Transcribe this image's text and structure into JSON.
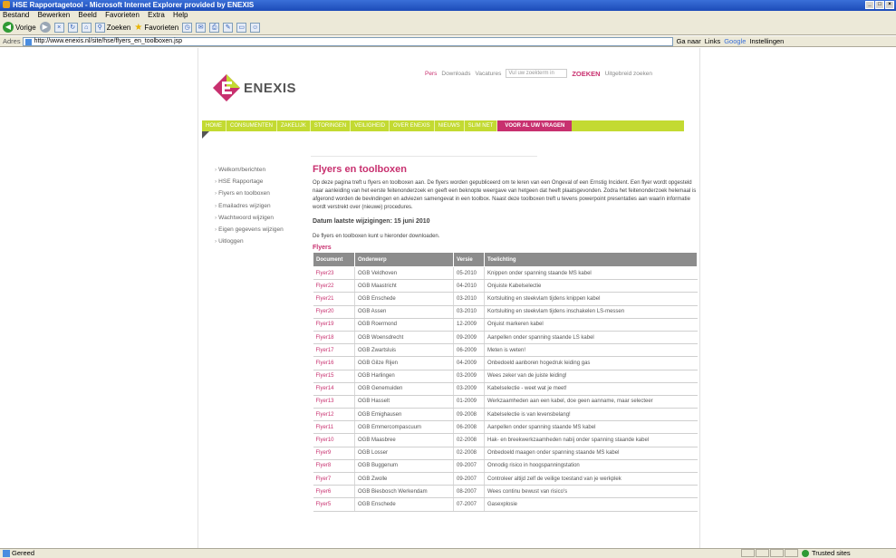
{
  "window": {
    "title": "HSE Rapportagetool - Microsoft Internet Explorer provided by ENEXIS"
  },
  "menubar": [
    "Bestand",
    "Bewerken",
    "Beeld",
    "Favorieten",
    "Extra",
    "Help"
  ],
  "toolbar": {
    "back": "Vorige",
    "search": "Zoeken",
    "favorites": "Favorieten"
  },
  "addressbar": {
    "label": "Adres",
    "url": "http://www.enexis.nl/site/hse/flyers_en_toolboxen.jsp",
    "go": "Ga naar",
    "links": "Links",
    "google": "Google",
    "settings": "Instellingen"
  },
  "site": {
    "logo": "ENEXIS",
    "topnav": {
      "pers": "Pers",
      "downloads": "Downloads",
      "vacatures": "Vacatures",
      "search_placeholder": "Vul uw zoekterm in",
      "search_button": "ZOEKEN",
      "advanced": "Uitgebreid zoeken"
    },
    "mainnav": [
      "HOME",
      "CONSUMENTEN",
      "ZAKELIJK",
      "STORINGEN",
      "VEILIGHEID",
      "OVER ENEXIS",
      "NIEUWS",
      "SLIM NET",
      "VOOR AL UW VRAGEN"
    ],
    "sidebar": [
      "Welkom/berichten",
      "HSE Rapportage",
      "Flyers en toolboxen",
      "Emailadres wijzigen",
      "Wachtwoord wijzigen",
      "Eigen gegevens wijzigen",
      "Uitloggen"
    ],
    "main": {
      "title": "Flyers en toolboxen",
      "intro": "Op deze pagina treft u flyers en toolboxen aan. De flyers worden gepubliceerd om te leren van een Ongeval of een Ernstig Incident. Een flyer wordt opgesteld naar aanleiding van het eerste feitenonderzoek en geeft een beknopte weergave van hetgeen dat heeft plaatsgevonden. Zodra het feitenonderzoek helemaal is afgerond worden de bevindingen en adviezen samengevat in een toolbox. Naast deze toolboxen treft u tevens powerpoint presentaties aan waarin informatie wordt verstrekt over (nieuwe) procedures.",
      "datum": "Datum laatste wijzigingen: 15 juni 2010",
      "instructie": "De flyers en toolboxen kunt u hieronder downloaden.",
      "flyers_heading": "Flyers",
      "table": {
        "headers": [
          "Document",
          "Onderwerp",
          "Versie",
          "Toelichting"
        ],
        "rows": [
          [
            "Flyer23",
            "OGB Veldhoven",
            "05-2010",
            "Knippen onder spanning staande MS kabel"
          ],
          [
            "Flyer22",
            "OGB Maastricht",
            "04-2010",
            "Onjuiste Kabelselectie"
          ],
          [
            "Flyer21",
            "OGB Enschede",
            "03-2010",
            "Kortsluiting en steekvlam tijdens knippen kabel"
          ],
          [
            "Flyer20",
            "OGB Assen",
            "03-2010",
            "Kortsluiting en steekvlam tijdens inschakelen LS-messen"
          ],
          [
            "Flyer19",
            "OGB Roermond",
            "12-2009",
            "Onjuist markeren kabel"
          ],
          [
            "Flyer18",
            "OGB Woensdrecht",
            "09-2009",
            "Aanpellen onder spanning staande LS kabel"
          ],
          [
            "Flyer17",
            "OGB Zwartsluis",
            "06-2009",
            "Meten is weten!"
          ],
          [
            "Flyer16",
            "OGB Gilze Rijen",
            "04-2009",
            "Onbedoeld aanboren hogedruk leiding gas"
          ],
          [
            "Flyer15",
            "OGB Harlingen",
            "03-2009",
            "Wees zeker van de juiste leiding!"
          ],
          [
            "Flyer14",
            "OGB Genemuiden",
            "03-2009",
            "Kabelselectie - weet wat je meet!"
          ],
          [
            "Flyer13",
            "OGB Hasselt",
            "01-2009",
            "Werkzaamheden aan een kabel, doe geen aanname, maar selecteer"
          ],
          [
            "Flyer12",
            "OGB Emighausen",
            "09-2008",
            "Kabelselectie is van levensbelang!"
          ],
          [
            "Flyer11",
            "OGB Emmercompascuum",
            "06-2008",
            "Aanpellen onder spanning staande MS kabel"
          ],
          [
            "Flyer10",
            "OGB Maasbree",
            "02-2008",
            "Hak- en breekwerkzaamheden nabij onder spanning staande kabel"
          ],
          [
            "Flyer9",
            "OGB Losser",
            "02-2008",
            "Onbedoeld maagen onder spanning staande MS kabel"
          ],
          [
            "Flyer8",
            "OGB Buggenum",
            "09-2007",
            "Onnodig risico in hoogspanningstation"
          ],
          [
            "Flyer7",
            "OGB Zwolle",
            "09-2007",
            "Controleer altijd zelf de veilige toestand van je werkplek"
          ],
          [
            "Flyer6",
            "OGB Biesbosch Werkendam",
            "08-2007",
            "Wees continu bewust van risico's"
          ],
          [
            "Flyer5",
            "OGB Enschede",
            "07-2007",
            "Gasexplosie"
          ]
        ]
      }
    }
  },
  "statusbar": {
    "text": "Gereed",
    "zone": "Trusted sites"
  },
  "colors": {
    "brand_pink": "#c8306f",
    "brand_green": "#c3da32",
    "table_header": "#8c8c8c"
  }
}
